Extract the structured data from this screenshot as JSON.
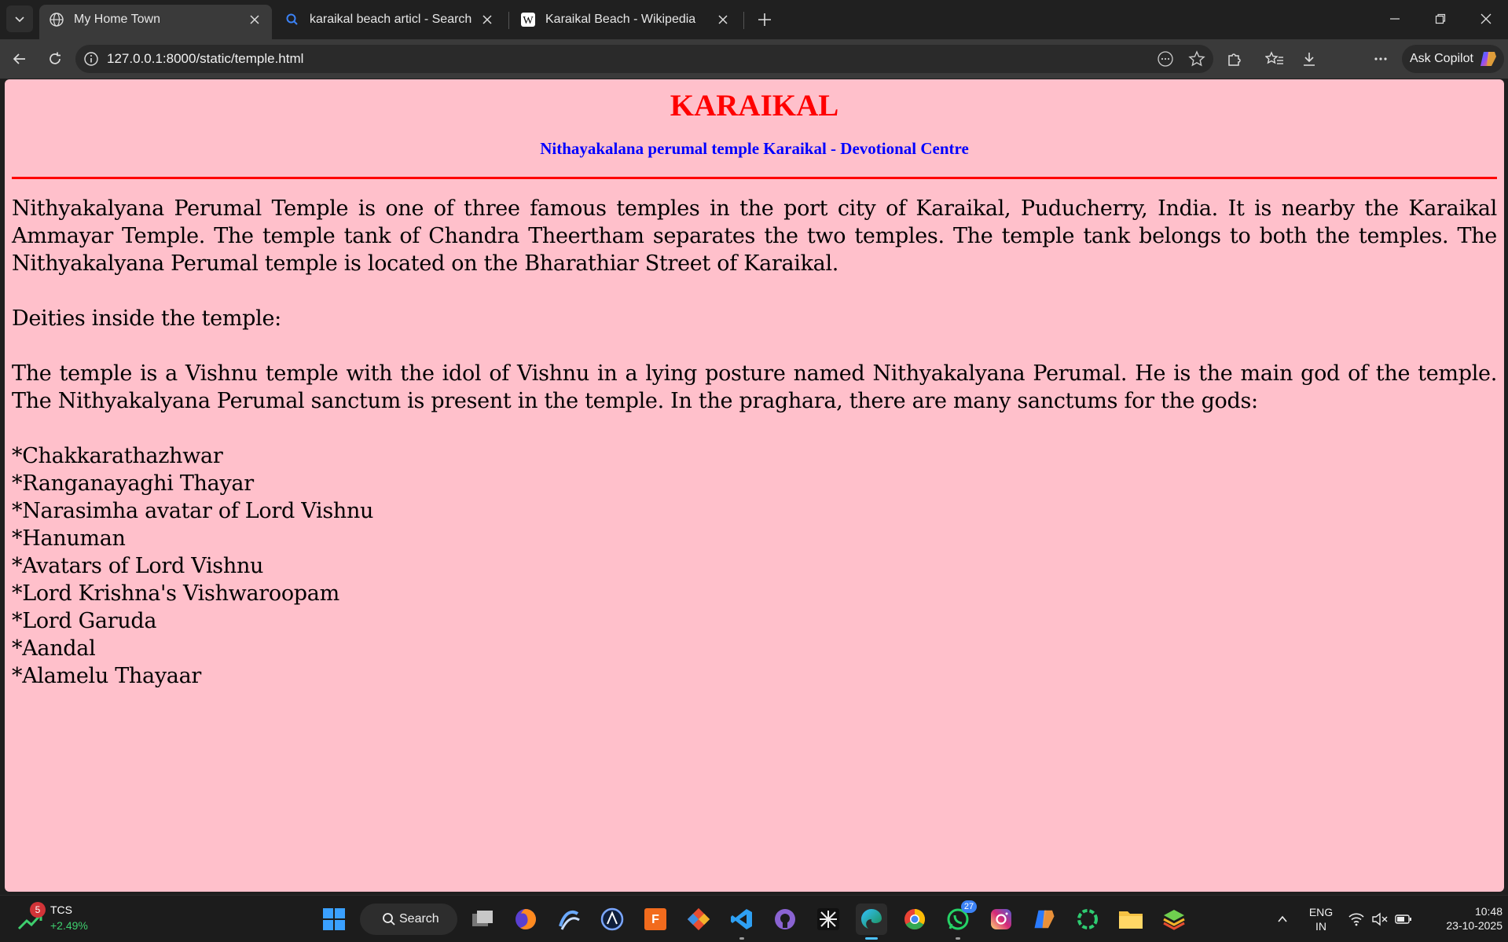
{
  "browser": {
    "tabs": [
      {
        "title": "My Home Town",
        "active": true,
        "favicon": "globe-icon"
      },
      {
        "title": "karaikal beach articl - Search",
        "active": false,
        "favicon": "search-icon"
      },
      {
        "title": "Karaikal Beach - Wikipedia",
        "active": false,
        "favicon": "wikipedia-icon"
      }
    ],
    "url": "127.0.0.1:8000/static/temple.html",
    "copilot_label": "Ask Copilot"
  },
  "page": {
    "title": "KARAIKAL",
    "subtitle": "Nithayakalana perumal temple Karaikal - Devotional Centre",
    "intro": "Nithyakalyana Perumal Temple is one of three famous temples in the port city of Karaikal, Puducherry, India. It is nearby the Karaikal Ammayar Temple. The temple tank of Chandra Theertham separates the two temples. The temple tank belongs to both the temples. The Nithyakalyana Perumal temple is located on the Bharathiar Street of Karaikal.",
    "deities_heading": "Deities inside the temple:",
    "description": "The temple is a Vishnu temple with the idol of Vishnu in a lying posture named Nithyakalyana Perumal. He is the main god of the temple. The Nithyakalyana Perumal sanctum is present in the temple. In the praghara, there are many sanctums for the gods:",
    "deities": [
      "*Chakkarathazhwar",
      "*Ranganayaghi Thayar",
      "*Narasimha avatar of Lord Vishnu",
      "*Hanuman",
      "*Avatars of Lord Vishnu",
      "*Lord Krishna's Vishwaroopam",
      "*Lord Garuda",
      "*Aandal",
      "*Alamelu Thayaar"
    ],
    "colors": {
      "background": "#ffc0cb",
      "title": "#ff0000",
      "subtitle": "#0000ff",
      "rule": "#ff0000"
    }
  },
  "taskbar": {
    "stock": {
      "badge": "5",
      "symbol": "TCS",
      "change": "+2.49%"
    },
    "search_label": "Search",
    "whatsapp_badge": "27",
    "language": {
      "line1": "ENG",
      "line2": "IN"
    },
    "clock": {
      "time": "10:48",
      "date": "23-10-2025"
    }
  }
}
